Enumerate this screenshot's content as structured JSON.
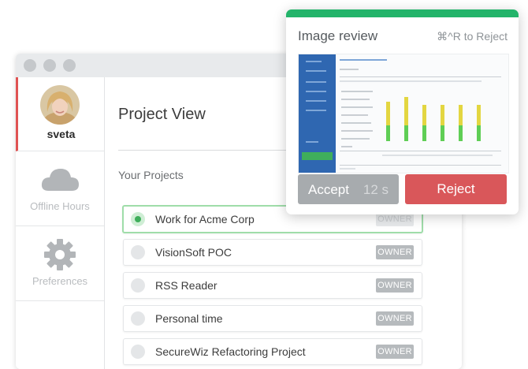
{
  "sidebar": {
    "user": {
      "name": "sveta"
    },
    "items": [
      {
        "label": "Offline Hours",
        "icon": "cloud-icon"
      },
      {
        "label": "Preferences",
        "icon": "gear-icon"
      }
    ]
  },
  "main": {
    "title": "Project View",
    "section_label": "Your Projects",
    "projects": [
      {
        "name": "Work for Acme Corp",
        "badge": "OWNER",
        "selected": true
      },
      {
        "name": "VisionSoft POC",
        "badge": "OWNER",
        "selected": false
      },
      {
        "name": "RSS Reader",
        "badge": "OWNER",
        "selected": false
      },
      {
        "name": "Personal time",
        "badge": "OWNER",
        "selected": false
      },
      {
        "name": "SecureWiz Refactoring Project",
        "badge": "OWNER",
        "selected": false
      }
    ]
  },
  "review": {
    "title": "Image review",
    "shortcut": "⌘^R to Reject",
    "accept_label": "Accept",
    "timer": "12 s",
    "reject_label": "Reject"
  },
  "colors": {
    "accent_green": "#23b46a",
    "reject_red": "#d9575a",
    "sidebar_blue": "#2f67b1",
    "active_user_marker": "#e05252"
  }
}
